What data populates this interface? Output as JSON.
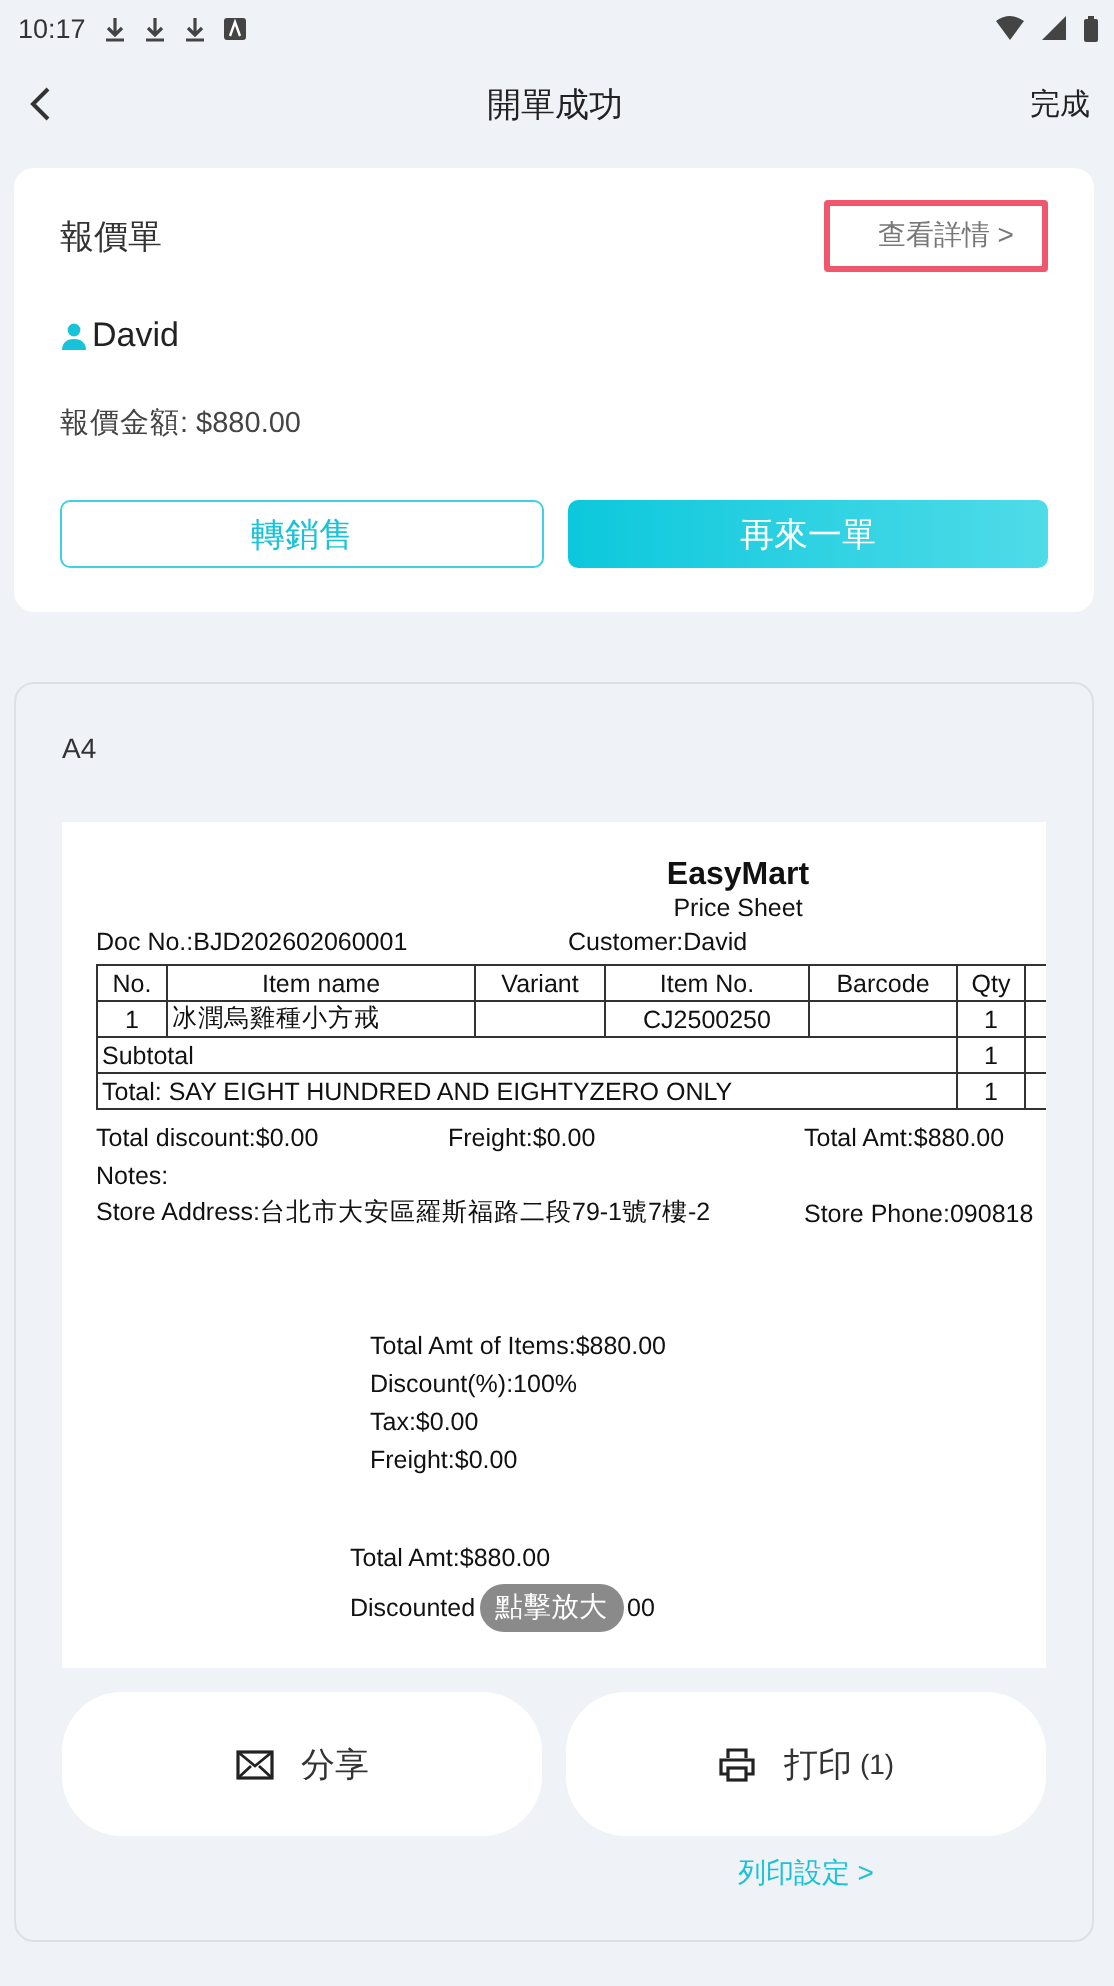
{
  "status_bar": {
    "time": "10:17"
  },
  "header": {
    "title": "開單成功",
    "action": "完成"
  },
  "quote_card": {
    "title": "報價單",
    "detail_link": "查看詳情 >",
    "highlighted": true,
    "customer": "David",
    "amount": "報價金額: $880.00",
    "buttons": [
      {
        "label": "轉銷售",
        "kind": "outline"
      },
      {
        "label": "再來一單",
        "kind": "filled"
      }
    ]
  },
  "preview_card": {
    "paper_size": "A4",
    "document": {
      "store_name": "EasyMart",
      "doc_title": "Price Sheet",
      "doc_no": "Doc No.:BJD202602060001",
      "customer": "Customer:David",
      "columns": [
        "No.",
        "Item name",
        "Variant",
        "Item No.",
        "Barcode",
        "Qty"
      ],
      "rows": [
        [
          "1",
          "冰潤烏雞種小方戒",
          "",
          "CJ2500250",
          "",
          "1"
        ]
      ],
      "subtotal": {
        "label": "Subtotal",
        "qty": "1"
      },
      "total": {
        "label": "Total: SAY EIGHT HUNDRED AND EIGHTYZERO ONLY",
        "qty": "1"
      },
      "totals": [
        "Total discount:$0.00",
        "Freight:$0.00",
        "Total Amt:$880.00"
      ],
      "notes": "Notes:",
      "store_address": "Store Address:台北市大安區羅斯福路二段79-1號7樓-2",
      "store_phone": "Store Phone:090818",
      "summary": [
        "Total Amt of Items:$880.00",
        "Discount(%):100%",
        "Tax:$0.00",
        "Freight:$0.00"
      ],
      "total_amt": "Total Amt:$880.00",
      "discounted_start": "Discounted",
      "discounted_end": "00"
    },
    "zoom_hint": "點擊放大",
    "actions": [
      {
        "kind": "share",
        "label": "分享"
      },
      {
        "kind": "print",
        "label": "打印",
        "count": "(1)"
      }
    ],
    "print_settings_link": "列印設定 >"
  }
}
